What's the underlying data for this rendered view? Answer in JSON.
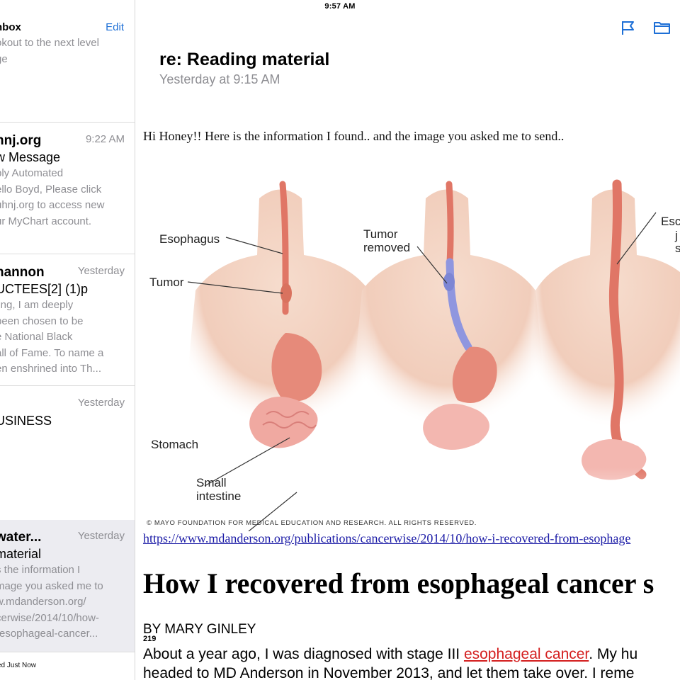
{
  "status_bar": {
    "time": "9:57 AM"
  },
  "sidebar": {
    "title": "nbox",
    "edit_label": "Edit",
    "top_fragment": "okout to the next level\nge",
    "messages": [
      {
        "sender": "hnj.org",
        "time": "9:22 AM",
        "subject": "w Message",
        "preview": "ply Automated\nello Boyd, Please click\nuhnj.org to access new\nur MyChart account."
      },
      {
        "sender": "hannon",
        "time": "Yesterday",
        "subject": "UCTEES[2] (1)p",
        "preview": "ling, I am deeply\nbeen chosen to be\ne National Black\nall of Fame. To name a\nen enshrined into Th..."
      },
      {
        "sender": "",
        "time": "Yesterday",
        "subject": "USINESS",
        "preview": ""
      },
      {
        "sender": "water...",
        "time": "Yesterday",
        "subject": "material",
        "preview": "s the information I\nmage you asked me to\nw.mdanderson.org/\ncerwise/2014/10/how-\n-esophageal-cancer..."
      }
    ],
    "footer": "ed Just Now"
  },
  "toolbar": {
    "flag_icon": "flag-icon",
    "folder_icon": "folder-icon",
    "accent": "#1d6fd6"
  },
  "email": {
    "subject": "re: Reading material",
    "datetime": "Yesterday at 9:15 AM",
    "greeting": "Hi Honey!! Here is the information I found.. and the image you asked me to send..",
    "figure_labels": {
      "esophagus": "Esophagus",
      "tumor": "Tumor",
      "tumor_removed_1": "Tumor",
      "tumor_removed_2": "removed",
      "stomach": "Stomach",
      "small_intestine_1": "Small",
      "small_intestine_2": "intestine",
      "cut_1": "Esc",
      "cut_2": "j",
      "cut_3": "s"
    },
    "copyright": "© MAYO FOUNDATION FOR MEDICAL EDUCATION AND RESEARCH. ALL RIGHTS RESERVED.",
    "link": "https://www.mdanderson.org/publications/cancerwise/2014/10/how-i-recovered-from-esophage",
    "headline": "How I recovered from esophageal cancer s",
    "byline": "BY MARY GINLEY",
    "page_number": "219",
    "para_line1_a": "About a year ago, I was diagnosed with stage III ",
    "para_line1_link": "esophageal cancer",
    "para_line1_b": ". My hu",
    "para_line2": "headed to MD Anderson in November 2013, and let them take over. I reme"
  }
}
